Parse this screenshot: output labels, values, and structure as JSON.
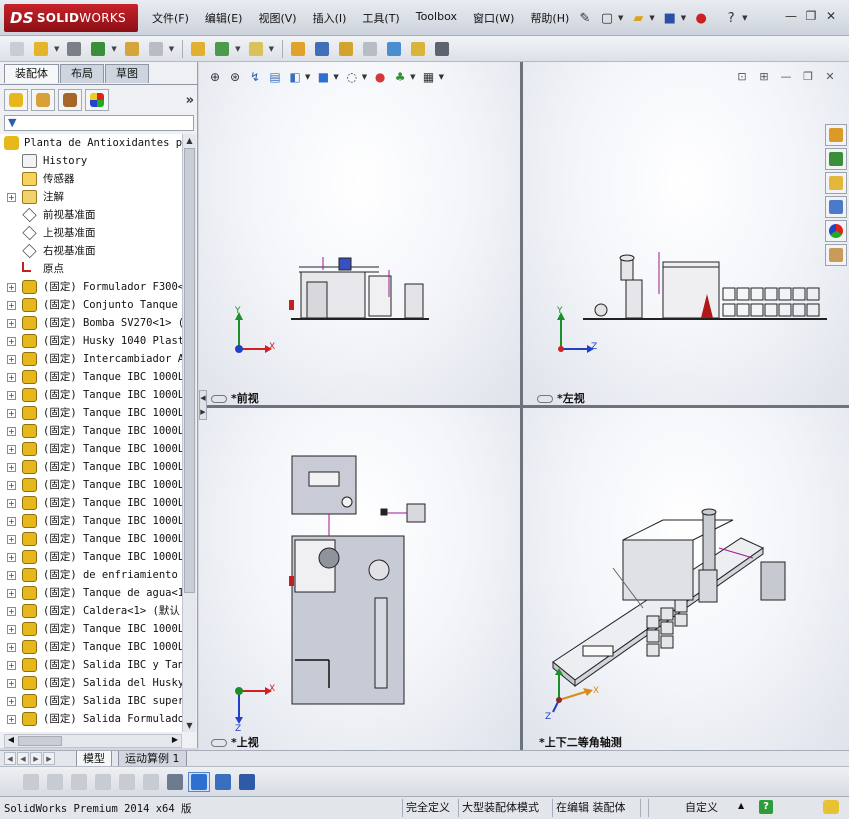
{
  "app": {
    "logo_prefix": "DS",
    "logo_solid": "SOLID",
    "logo_works": "WORKS"
  },
  "menus": [
    "文件(F)",
    "编辑(E)",
    "视图(V)",
    "插入(I)",
    "工具(T)",
    "Toolbox",
    "窗口(W)",
    "帮助(H)"
  ],
  "panel": {
    "tabs": [
      "装配体",
      "布局",
      "草图"
    ],
    "more_label": "»",
    "filter_label": "▼"
  },
  "tree": {
    "root": "Planta de Antioxidantes pa",
    "items": [
      {
        "label": "History",
        "icon": "history",
        "expand": false
      },
      {
        "label": "传感器",
        "icon": "sensor",
        "expand": false
      },
      {
        "label": "注解",
        "icon": "annotation",
        "expand": true
      },
      {
        "label": "前视基准面",
        "icon": "plane",
        "expand": false
      },
      {
        "label": "上视基准面",
        "icon": "plane",
        "expand": false
      },
      {
        "label": "右视基准面",
        "icon": "plane",
        "expand": false
      },
      {
        "label": "原点",
        "icon": "origin",
        "expand": false
      },
      {
        "label": "(固定) Formulador F300<",
        "icon": "part",
        "expand": true
      },
      {
        "label": "(固定) Conjunto Tanque ",
        "icon": "part",
        "expand": true
      },
      {
        "label": "(固定) Bomba SV270<1> (",
        "icon": "part",
        "expand": true
      },
      {
        "label": "(固定) Husky 1040 Plast",
        "icon": "part",
        "expand": true
      },
      {
        "label": "(固定) Intercambiador A",
        "icon": "part",
        "expand": true
      },
      {
        "label": "(固定) Tanque IBC 1000L",
        "icon": "part",
        "expand": true
      },
      {
        "label": "(固定) Tanque IBC 1000L",
        "icon": "part",
        "expand": true
      },
      {
        "label": "(固定) Tanque IBC 1000L",
        "icon": "part",
        "expand": true
      },
      {
        "label": "(固定) Tanque IBC 1000L",
        "icon": "part",
        "expand": true
      },
      {
        "label": "(固定) Tanque IBC 1000L",
        "icon": "part",
        "expand": true
      },
      {
        "label": "(固定) Tanque IBC 1000L",
        "icon": "part",
        "expand": true
      },
      {
        "label": "(固定) Tanque IBC 1000L",
        "icon": "part",
        "expand": true
      },
      {
        "label": "(固定) Tanque IBC 1000L",
        "icon": "part",
        "expand": true
      },
      {
        "label": "(固定) Tanque IBC 1000L",
        "icon": "part",
        "expand": true
      },
      {
        "label": "(固定) Tanque IBC 1000L",
        "icon": "part",
        "expand": true
      },
      {
        "label": "(固定) Tanque IBC 1000L",
        "icon": "part",
        "expand": true
      },
      {
        "label": "(固定) de enfriamiento",
        "icon": "part",
        "expand": true
      },
      {
        "label": "(固定) Tanque de agua<1",
        "icon": "part",
        "expand": true
      },
      {
        "label": "(固定) Caldera<1> (默认",
        "icon": "part",
        "expand": true
      },
      {
        "label": "(固定) Tanque IBC 1000L",
        "icon": "part",
        "expand": true
      },
      {
        "label": "(固定) Tanque IBC 1000L",
        "icon": "part",
        "expand": true
      },
      {
        "label": "(固定) Salida IBC y Tan",
        "icon": "part",
        "expand": true
      },
      {
        "label": "(固定) Salida del Husky",
        "icon": "part",
        "expand": true
      },
      {
        "label": "(固定) Salida IBC super",
        "icon": "part",
        "expand": true
      },
      {
        "label": "(固定) Salida Formulado",
        "icon": "part",
        "expand": true
      }
    ]
  },
  "viewports": {
    "front": {
      "label": "*前视",
      "x_axis": "X",
      "y_axis": "Y"
    },
    "left": {
      "label": "*左视",
      "z_axis": "Z",
      "y_axis": "Y"
    },
    "top": {
      "label": "*上视",
      "x_axis": "X",
      "z_axis": "Z"
    },
    "iso": {
      "label": "*上下二等角轴测",
      "x_axis": "X",
      "z_axis": "Z"
    }
  },
  "bottom_tabs": [
    "模型",
    "运动算例 1"
  ],
  "status": {
    "product": "SolidWorks Premium 2014 x64 版",
    "defined": "完全定义",
    "mode": "大型装配体模式",
    "editing": "在编辑 装配体",
    "custom": "自定义",
    "help": "?"
  },
  "colors": {
    "brand_red": "#b31b22",
    "axis_x": "#d02020",
    "axis_y": "#1d8f2a",
    "axis_z": "#2040c8",
    "tree_part_icon": "#e6b81c"
  }
}
